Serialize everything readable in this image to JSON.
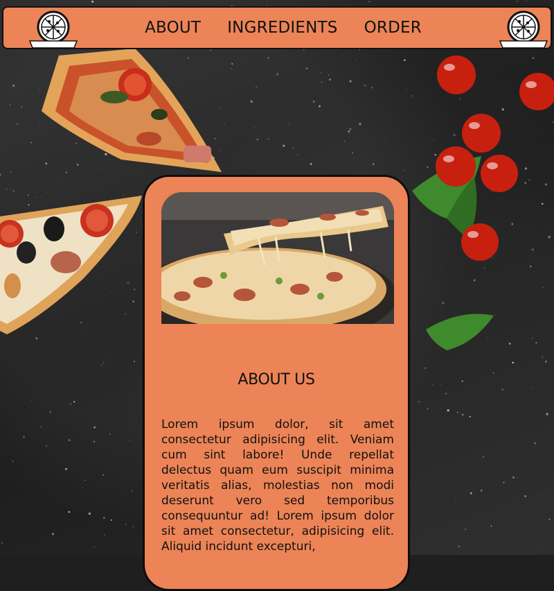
{
  "nav": {
    "items": [
      {
        "label": "ABOUT"
      },
      {
        "label": "INGREDIENTS"
      },
      {
        "label": "ORDER"
      }
    ],
    "logo_icon": "pizza-logo-icon"
  },
  "card": {
    "title": "ABOUT US",
    "body": "Lorem ipsum dolor, sit amet consectetur adipisicing elit. Veniam cum sint labore! Unde repellat delectus quam eum suscipit minima veritatis alias, molestias non modi deserunt vero sed temporibus consequuntur ad! Lorem ipsum dolor sit amet consectetur, adipisicing elit. Aliquid incidunt excepturi,",
    "photo": "pizza-slice-photo"
  },
  "colors": {
    "accent": "#ec8457",
    "outline": "#111111",
    "background": "#1f1f1f"
  }
}
